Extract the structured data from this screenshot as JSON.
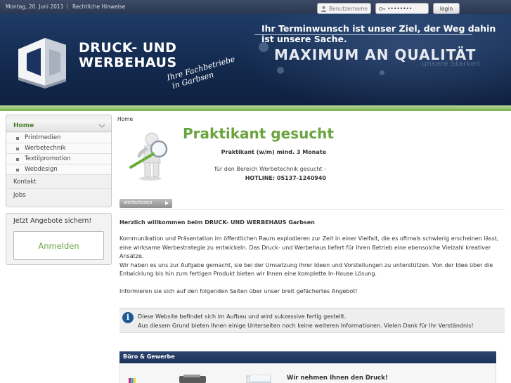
{
  "topbar": {
    "date": "Montag, 20. Juni 2011",
    "separator": "|",
    "legal_link": "Rechtliche Hinweise",
    "username_placeholder": "Benutzername",
    "password_value": "••••••••",
    "login_label": "login"
  },
  "header": {
    "brand_line1": "DRUCK- UND",
    "brand_line2": "WERBEHAUS",
    "slogan_line1": "Ihre Fachbetriebe",
    "slogan_line2": "in Garbsen",
    "tagline": "Ihr Terminwunsch ist unser Ziel, der Weg dahin ist unsere Sache.",
    "headline": "MAXIMUM AN QUALITÄT",
    "headline_ghost": "unsere Stärken"
  },
  "nav": {
    "home": "Home",
    "sub_items": [
      "Printmedien",
      "Werbetechnik",
      "Textilpromotion",
      "Webdesign"
    ],
    "contact": "Kontakt",
    "jobs": "Jobs"
  },
  "offer": {
    "title": "Jetzt Angebote sichern!",
    "register_label": "Anmelden"
  },
  "main": {
    "breadcrumb": "Home",
    "promo": {
      "title": "Praktikant gesucht",
      "line1": "Praktikant (w/m) mind. 3 Monate",
      "line2": "für den Bereich Werbetechnik gesucht -",
      "line3": "HOTLINE: 05137-1240940",
      "more_label": "weiterlesen"
    },
    "welcome": "Herzlich willkommen beim DRUCK- UND WERBEHAUS Garbsen",
    "paragraphs": [
      "Kommunikation und Präsentation im öffentlichen Raum explodieren zur Zeit in einer Vielfalt, die es oftmals schwierig erscheinen lässt, eine wirksame Werbestrategie zu entwickeln. Das Druck- und Werbehaus liefert für Ihren Betrieb eine ebensolche Vielzahl kreativer Ansätze.",
      "Wir haben es uns zur Aufgabe gemacht, sie bei der Umsetzung Ihrer Ideen und Vorstellungen zu unterstützen. Von der Idee über die Entwicklung bis hin zum fertigen Produkt bieten wir Ihnen eine komplette In-House Lösung.",
      "Informieren sie sich auf den folgenden Seiten über unser breit gefächertes Angebot!"
    ],
    "info": {
      "icon": "i",
      "line1": "Diese Website befindet sich im Aufbau und wird sukzessive fertig gestellt.",
      "line2": "Aus diesem Grund bieten Ihnen einige Unterseiten noch keine weiteren Informationen. Vielen Dank für Ihr Verständnis!"
    },
    "section": {
      "title": "Büro & Gewerbe",
      "teaser": "Wir nehmen Ihnen den Druck!"
    }
  },
  "colors": {
    "brand_green": "#6aa43e",
    "header_navy": "#13294d",
    "info_blue": "#1e5b94"
  }
}
